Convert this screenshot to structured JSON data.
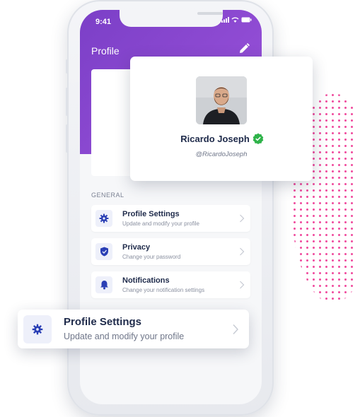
{
  "status_bar": {
    "time": "9:41"
  },
  "header": {
    "title": "Profile"
  },
  "profile": {
    "name": "Ricardo Joseph",
    "handle": "@RicardoJoseph"
  },
  "section": {
    "label": "GENERAL"
  },
  "settings": [
    {
      "title": "Profile Settings",
      "subtitle": "Update and modify your profile",
      "icon": "gear-icon"
    },
    {
      "title": "Privacy",
      "subtitle": "Change your password",
      "icon": "shield-icon"
    },
    {
      "title": "Notifications",
      "subtitle": "Change your notification settings",
      "icon": "bell-icon"
    }
  ],
  "highlight": {
    "title": "Profile Settings",
    "subtitle": "Update and modify your profile",
    "icon": "gear-icon"
  },
  "colors": {
    "accent": "#8f4bd3",
    "icon_blue": "#2a3fb5",
    "verified": "#2fb34a",
    "dots": "#f0459a"
  }
}
